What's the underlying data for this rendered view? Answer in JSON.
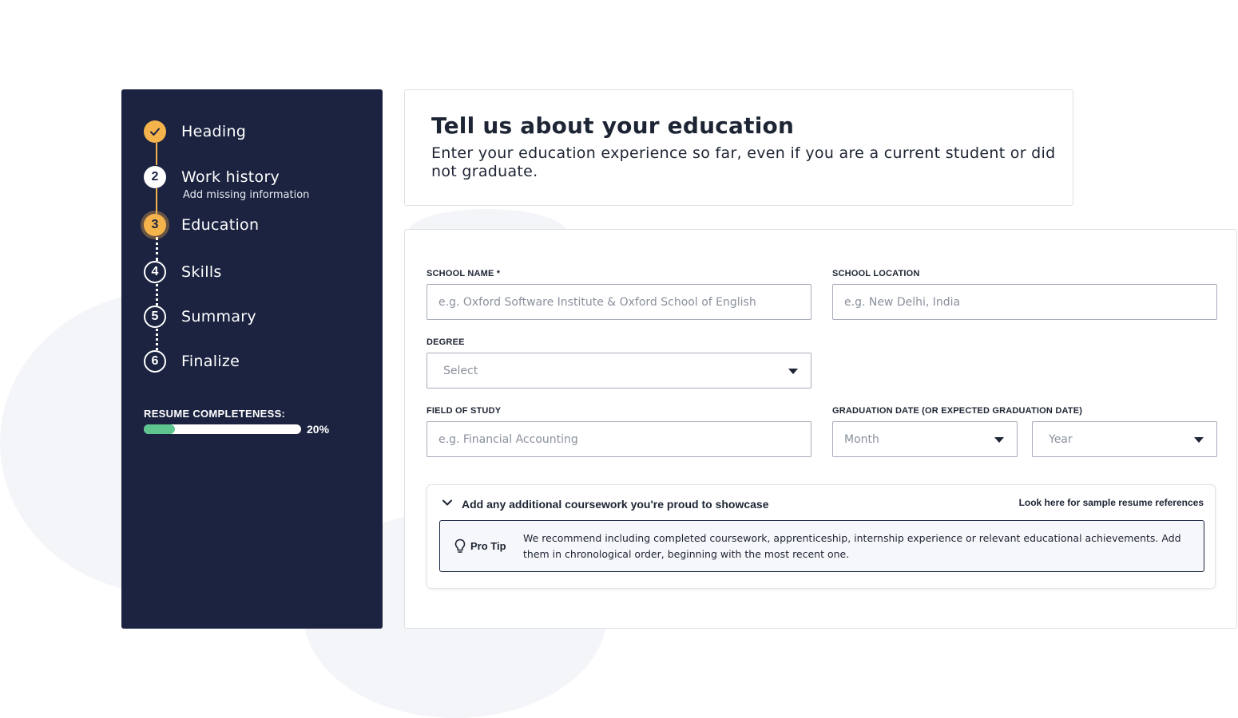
{
  "sidebar": {
    "steps": [
      {
        "label": "Heading",
        "status": "done"
      },
      {
        "label": "Work history",
        "number": "2",
        "status": "visited",
        "sub": "Add missing information"
      },
      {
        "label": "Education",
        "number": "3",
        "status": "current"
      },
      {
        "label": "Skills",
        "number": "4",
        "status": "todo"
      },
      {
        "label": "Summary",
        "number": "5",
        "status": "todo"
      },
      {
        "label": "Finalize",
        "number": "6",
        "status": "todo"
      }
    ],
    "completeness_label": "RESUME COMPLETENESS:",
    "completeness_pct": "20%",
    "completeness_value": 20
  },
  "header": {
    "title": "Tell us about your education",
    "subtitle": "Enter your education experience so far, even if you are a current student or did not graduate."
  },
  "form": {
    "school_name_label": "SCHOOL NAME *",
    "school_name_placeholder": "e.g. Oxford Software Institute & Oxford School of English",
    "school_location_label": "SCHOOL LOCATION",
    "school_location_placeholder": "e.g. New Delhi, India",
    "degree_label": "DEGREE",
    "degree_value": "Select",
    "field_label": "FIELD OF STUDY",
    "field_placeholder": "e.g. Financial Accounting",
    "grad_label": "GRADUATION DATE (OR EXPECTED GRADUATION DATE)",
    "month_value": "Month",
    "year_value": "Year"
  },
  "coursework": {
    "title": "Add any additional coursework you're proud to showcase",
    "link": "Look here for sample resume references",
    "tip_label": "Pro Tip",
    "tip_text": "We recommend including completed coursework, apprenticeship, internship experience or relevant educational achievements. Add them in chronological order, beginning with the most recent one."
  },
  "colors": {
    "sidebar_bg": "#1b2340",
    "accent": "#f5b34c",
    "progress": "#5fc58f"
  }
}
